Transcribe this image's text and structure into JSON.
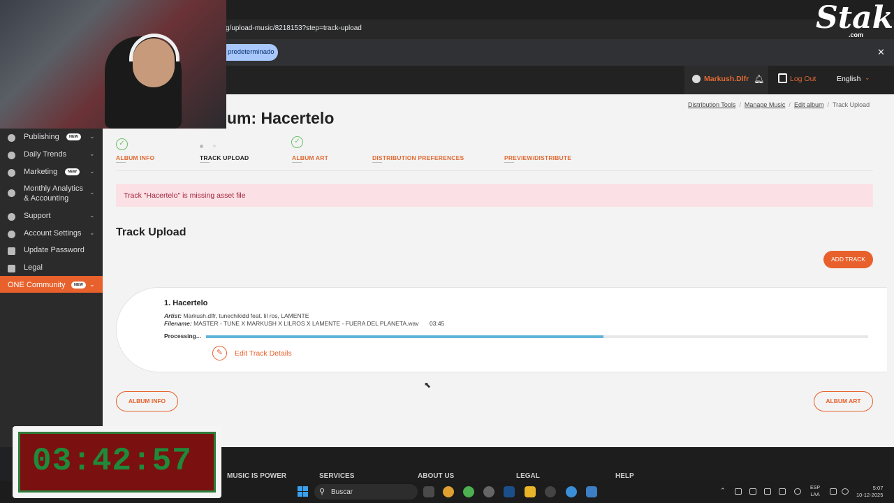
{
  "browser": {
    "url": "g/upload-music/8218153?step=track-upload",
    "infobar_button": "predeterminado",
    "close_glyph": "✕"
  },
  "header": {
    "username": "Markush.Dlfr",
    "logout": "Log Out",
    "language": "English"
  },
  "sidebar": {
    "items": [
      {
        "label": "Publishing",
        "badge": "NEW"
      },
      {
        "label": "Daily Trends",
        "badge": ""
      },
      {
        "label": "Marketing",
        "badge": "NEW"
      },
      {
        "label": "Monthly Analytics",
        "label2": "& Accounting",
        "badge": ""
      },
      {
        "label": "Support",
        "badge": ""
      },
      {
        "label": "Account Settings",
        "badge": ""
      },
      {
        "label": "Update Password",
        "badge": ""
      },
      {
        "label": "Legal",
        "badge": ""
      },
      {
        "label": "ONE Community",
        "badge": "NEW"
      }
    ]
  },
  "breadcrumb": [
    "Distribution Tools",
    "Manage Music",
    "Edit album",
    "Track Upload"
  ],
  "page_title": "um: Hacertelo",
  "steps": [
    {
      "label": "ALBUM INFO",
      "state": "done"
    },
    {
      "label": "TRACK UPLOAD",
      "state": "current"
    },
    {
      "label": "ALBUM ART",
      "state": "done"
    },
    {
      "label": "DISTRIBUTION PREFERENCES",
      "state": "todo"
    },
    {
      "label": "PREVIEW/DISTRIBUTE",
      "state": "todo"
    }
  ],
  "alert": "Track \"Hacertelo\" is missing asset file",
  "section_title": "Track Upload",
  "add_track": "ADD TRACK",
  "track": {
    "title": "1. Hacertelo",
    "artist_label": "Artist:",
    "artist": "Markush.dlfr, tunechikidd feat. lil ros, LAMENTE",
    "filename_label": "Filename:",
    "filename": "MASTER - TUNE X MARKUSH X LILROS X LAMENTE - FUERA DEL PLANETA.wav",
    "duration": "03:45",
    "status": "Processing...",
    "progress": 0.6,
    "edit": "Edit Track Details"
  },
  "nav_buttons": {
    "back": "ALBUM INFO",
    "next": "ALBUM ART"
  },
  "footer": [
    "MUSIC IS POWER",
    "SERVICES",
    "ABOUT US",
    "LEGAL",
    "HELP"
  ],
  "taskbar": {
    "search": "Buscar",
    "lang1": "ESP",
    "lang2": "LAA",
    "time": "5:07",
    "date": "10-12-2025"
  },
  "overlay": {
    "brand": "Stake",
    "brand_sub": ".com",
    "timer": "03:42:57"
  },
  "colors": {
    "accent": "#e8612c",
    "success": "#6cc06c",
    "progress": "#5fb4d8",
    "alert_bg": "#fbe1e5"
  }
}
